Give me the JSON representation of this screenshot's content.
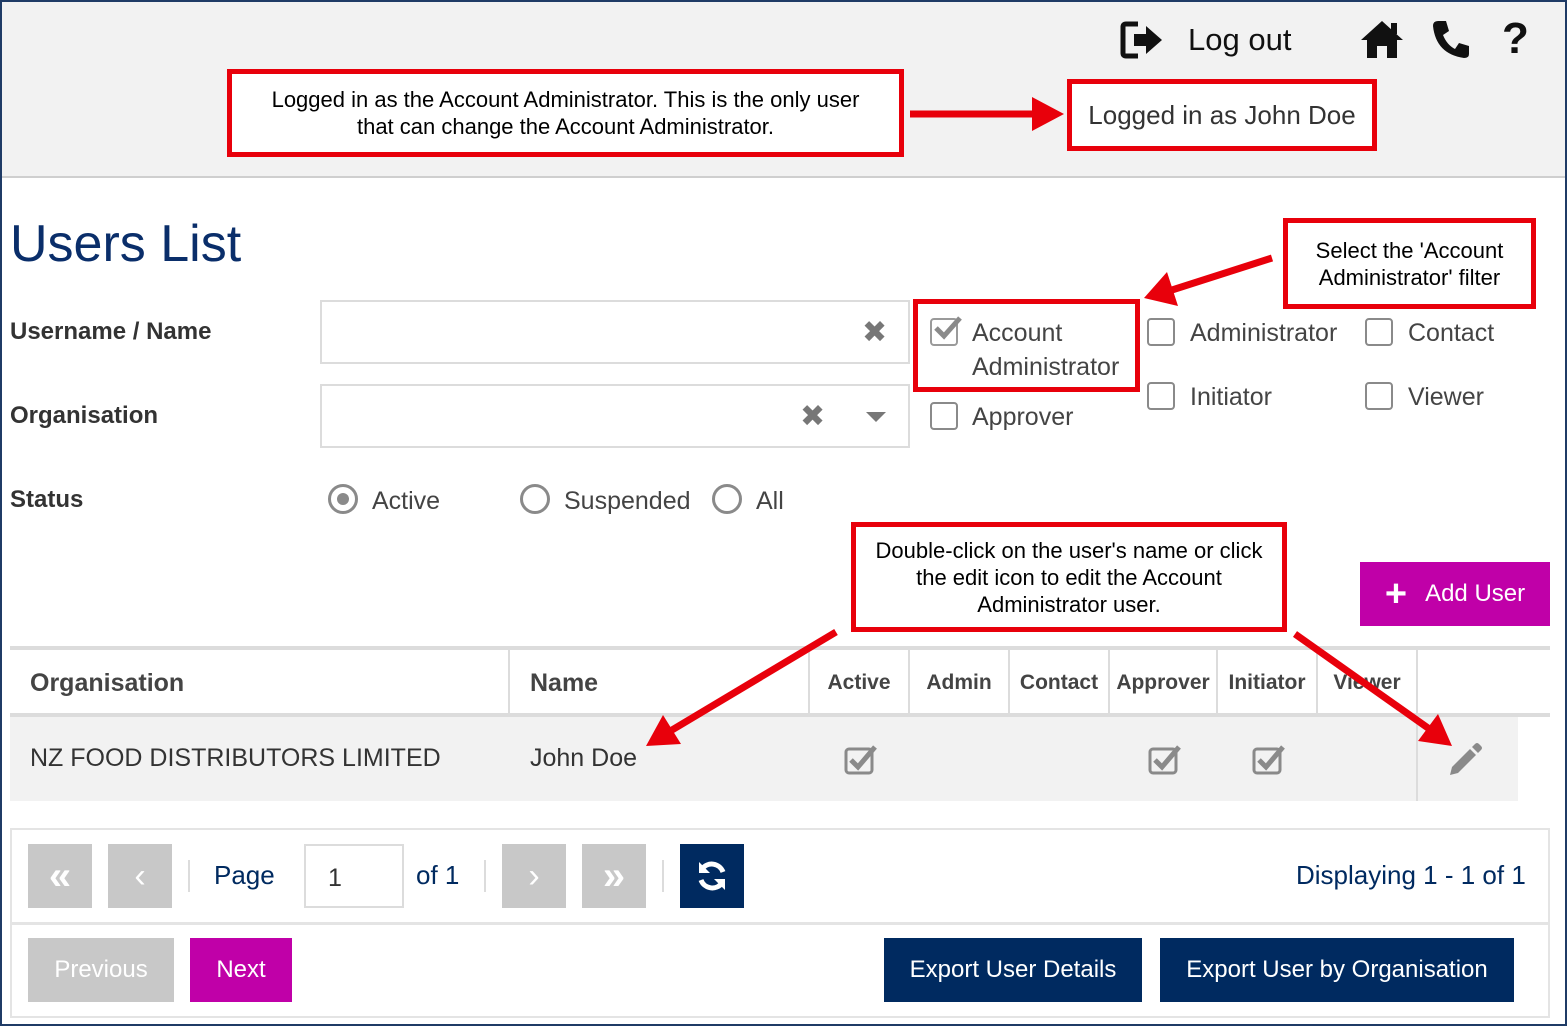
{
  "header": {
    "logout_label": "Log out",
    "logged_in_text": "Logged in as John Doe"
  },
  "callouts": {
    "top": "Logged in as the Account Administrator. This is the only user that can change the Account Administrator.",
    "filter": "Select the 'Account Administrator' filter",
    "edit": "Double-click on the user's name or click the edit icon to edit the Account Administrator user."
  },
  "page": {
    "title": "Users List"
  },
  "filters": {
    "username_label": "Username / Name",
    "username_value": "",
    "organisation_label": "Organisation",
    "organisation_value": "",
    "roles": {
      "account_admin": "Account Administrator",
      "approver": "Approver",
      "administrator": "Administrator",
      "initiator": "Initiator",
      "contact": "Contact",
      "viewer": "Viewer"
    },
    "status_label": "Status",
    "status_options": {
      "active": "Active",
      "suspended": "Suspended",
      "all": "All"
    },
    "status_selected": "Active"
  },
  "actions": {
    "add_user": "Add User"
  },
  "table": {
    "headers": {
      "organisation": "Organisation",
      "name": "Name",
      "active": "Active",
      "admin": "Admin",
      "contact": "Contact",
      "approver": "Approver",
      "initiator": "Initiator",
      "viewer": "Viewer"
    },
    "rows": [
      {
        "organisation": "NZ FOOD DISTRIBUTORS LIMITED",
        "name": "John Doe",
        "active": true,
        "admin": false,
        "contact": false,
        "approver": true,
        "initiator": true,
        "viewer": false
      }
    ]
  },
  "pager": {
    "page_label": "Page",
    "page_value": "1",
    "of_label": "of 1",
    "display_text": "Displaying 1 - 1 of 1"
  },
  "footer": {
    "previous": "Previous",
    "next": "Next",
    "export_details": "Export User Details",
    "export_by_org": "Export User by Organisation"
  },
  "colors": {
    "navy": "#002a60",
    "magenta": "#c000a8",
    "callout_red": "#e8000b",
    "disabled_gray": "#c8c8c8"
  }
}
